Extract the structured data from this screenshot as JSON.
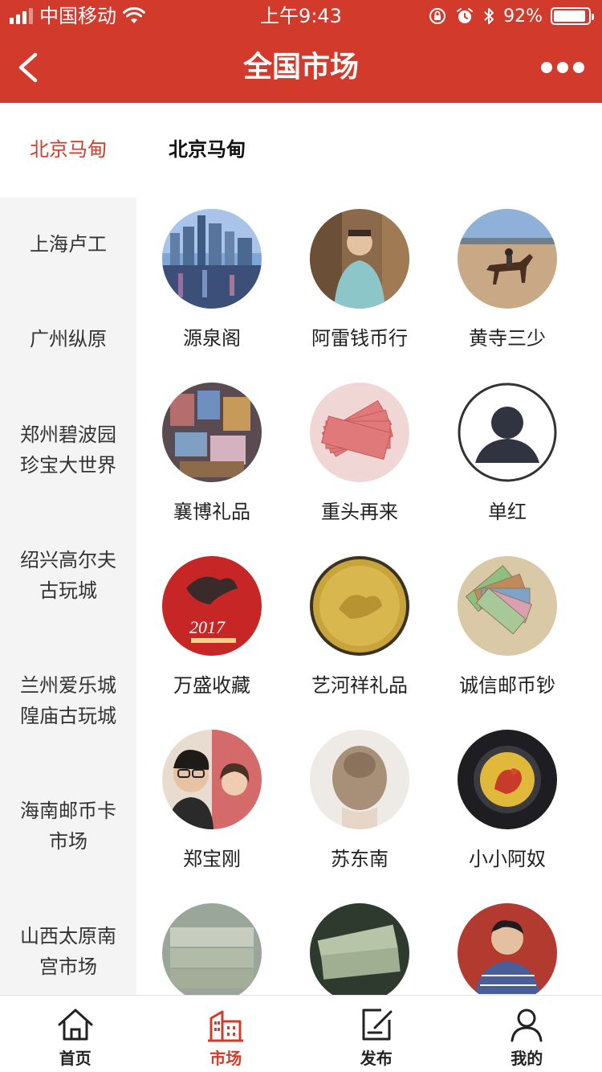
{
  "status_bar": {
    "carrier": "中国移动",
    "time": "上午9:43",
    "battery_percent": "92%",
    "battery_level": 0.92
  },
  "nav": {
    "title": "全国市场",
    "back_icon": "chevron-left-icon",
    "more_icon": "more-dots-icon"
  },
  "current_market": {
    "side_label": "北京马甸",
    "title": "北京马甸"
  },
  "sidebar": {
    "items": [
      {
        "label": "上海卢工"
      },
      {
        "label": "广州纵原"
      },
      {
        "label": "郑州碧波园珍宝大世界"
      },
      {
        "label": "绍兴高尔夫古玩城"
      },
      {
        "label": "兰州爱乐城隍庙古玩城"
      },
      {
        "label": "海南邮币卡市场"
      },
      {
        "label": "山西太原南宫市场"
      }
    ]
  },
  "shops": [
    {
      "name": "源泉阁"
    },
    {
      "name": "阿雷钱币行"
    },
    {
      "name": "黄寺三少"
    },
    {
      "name": "襄博礼品"
    },
    {
      "name": "重头再来"
    },
    {
      "name": "单红"
    },
    {
      "name": "万盛收藏"
    },
    {
      "name": "艺河祥礼品"
    },
    {
      "name": "诚信邮币钞"
    },
    {
      "name": "郑宝刚"
    },
    {
      "name": "苏东南"
    },
    {
      "name": "小小阿奴"
    },
    {
      "name": ""
    },
    {
      "name": ""
    },
    {
      "name": ""
    }
  ],
  "tabbar": {
    "items": [
      {
        "label": "首页",
        "icon": "home-icon"
      },
      {
        "label": "市场",
        "icon": "market-building-icon"
      },
      {
        "label": "发布",
        "icon": "publish-edit-icon"
      },
      {
        "label": "我的",
        "icon": "user-icon"
      }
    ],
    "active_index": 1
  },
  "colors": {
    "brand_red": "#d23a2b",
    "sidebar_bg": "#f4f4f4",
    "text": "#222222"
  }
}
